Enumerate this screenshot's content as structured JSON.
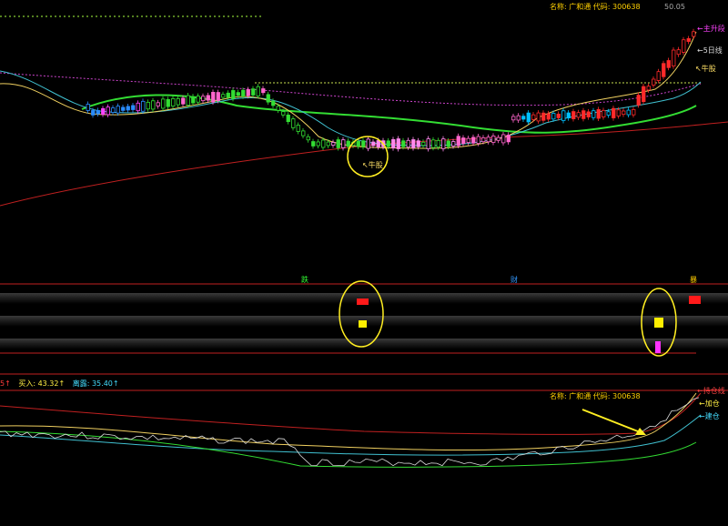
{
  "main": {
    "stock_info": "名称: 广和通  代码: 300638",
    "price_label": "50.05",
    "legend_rise": "←主升段",
    "legend_ma5": "←5日线",
    "niu_gu_top": "↖牛股",
    "niu_gu_bottom": "↖牛股"
  },
  "signals": {
    "labels": [
      {
        "text": "跌",
        "color": "#33ff33"
      },
      {
        "text": "财",
        "color": "#3399ff"
      },
      {
        "text": "暴",
        "color": "#ffcc00"
      }
    ]
  },
  "indicator": {
    "status": [
      {
        "text": "5↑"
      },
      {
        "text": "买入: 43.32↑"
      },
      {
        "text": "离露: 35.40↑"
      }
    ],
    "stock_info": "名称: 广和通  代码: 300638",
    "legend_top": "←持仓线",
    "legend_add": "←加仓",
    "legend_build": "←建仓"
  },
  "colors": {
    "up": "#ff2a2a",
    "down": "#00c0ff",
    "green_line": "#33dd33",
    "yellow_line": "#f0d060",
    "cyan_line": "#40c0d0",
    "red_line": "#c02020",
    "magenta": "#ff33ff",
    "annotation_circle": "#ffee22"
  }
}
